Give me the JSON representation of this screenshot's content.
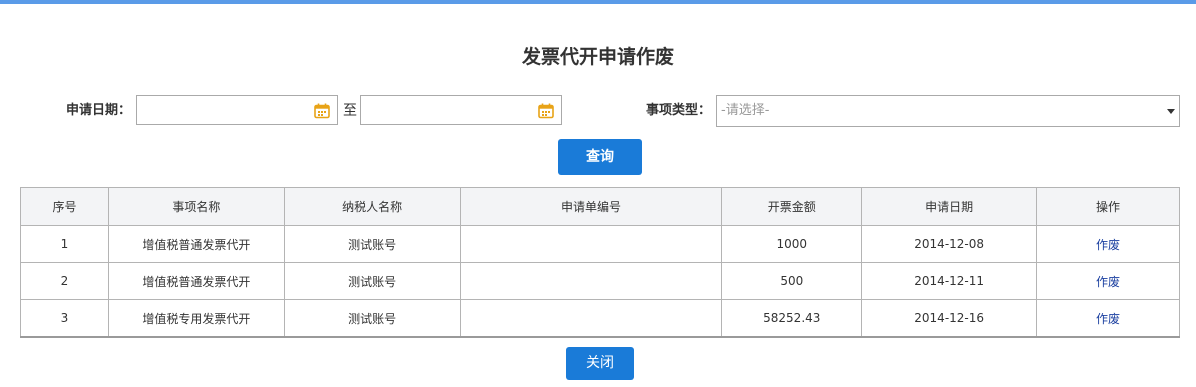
{
  "title": "发票代开申请作废",
  "filters": {
    "date_label": "申请日期：",
    "to_label": "至",
    "start_date": {
      "value": "",
      "placeholder": ""
    },
    "end_date": {
      "value": "",
      "placeholder": ""
    },
    "type_label": "事项类型：",
    "type_select": {
      "selected": "-请选择-"
    },
    "query_button": "查询"
  },
  "table": {
    "headers": [
      "序号",
      "事项名称",
      "纳税人名称",
      "申请单编号",
      "开票金额",
      "申请日期",
      "操作"
    ],
    "rows": [
      {
        "no": "1",
        "item": "增值税普通发票代开",
        "taxpayer": "测试账号",
        "app_no": "",
        "amount": "1000",
        "date": "2014-12-08",
        "action": "作废"
      },
      {
        "no": "2",
        "item": "增值税普通发票代开",
        "taxpayer": "测试账号",
        "app_no": "",
        "amount": "500",
        "date": "2014-12-11",
        "action": "作废"
      },
      {
        "no": "3",
        "item": "增值税专用发票代开",
        "taxpayer": "测试账号",
        "app_no": "",
        "amount": "58252.43",
        "date": "2014-12-16",
        "action": "作废"
      }
    ]
  },
  "close_button": "关闭",
  "colors": {
    "accent": "#1a7bd8",
    "top_bar": "#5a9be8",
    "calendar_icon": "#e8a317",
    "link": "#1a3fa0"
  },
  "icons": {
    "date_picker": "calendar-icon",
    "select": "chevron-down-icon"
  }
}
